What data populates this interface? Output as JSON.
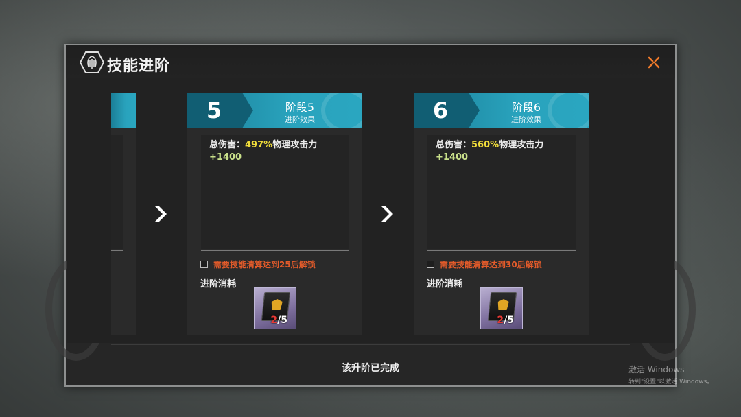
{
  "dialog": {
    "title": "技能进阶",
    "status": "该升阶已完成"
  },
  "stages": [
    {
      "number": "5",
      "title": "阶段5",
      "subtitle": "进阶效果",
      "effect_prefix": "总伤害：",
      "effect_value": "497%",
      "effect_suffix": "物理攻击力",
      "effect_bonus": "+1400",
      "unlock_text": "需要技能清算达到25后解锁",
      "cost_label": "进阶消耗",
      "item": {
        "have": "2",
        "need": "/5",
        "icon": "skill-book-icon"
      }
    },
    {
      "number": "6",
      "title": "阶段6",
      "subtitle": "进阶效果",
      "effect_prefix": "总伤害：",
      "effect_value": "560%",
      "effect_suffix": "物理攻击力",
      "effect_bonus": "+1400",
      "unlock_text": "需要技能清算达到30后解锁",
      "cost_label": "进阶消耗",
      "item": {
        "have": "2",
        "need": "/5",
        "icon": "skill-book-icon"
      }
    }
  ],
  "watermark": {
    "line1": "激活 Windows",
    "line2": "转到\"设置\"以激活 Windows。"
  },
  "colors": {
    "accent_teal": "#29a3bd",
    "accent_dark_teal": "#115e73",
    "highlight_yellow": "#f0dc3a",
    "bonus_green": "#c9e08a",
    "warning_orange": "#e35b2a",
    "close_orange": "#f07a2a"
  }
}
